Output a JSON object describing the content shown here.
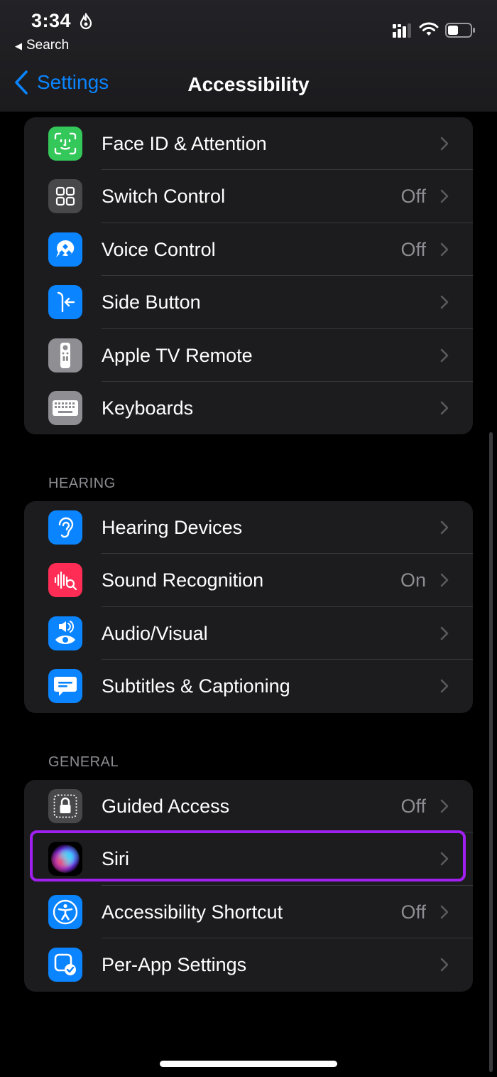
{
  "status_bar": {
    "time": "3:34",
    "back_app": "Search",
    "icons": [
      "focus-mode-icon",
      "cellular-signal-icon",
      "wifi-icon",
      "battery-icon"
    ]
  },
  "nav": {
    "back_label": "Settings",
    "title": "Accessibility"
  },
  "groups": {
    "physical": {
      "items": [
        {
          "label": "Face ID & Attention",
          "value": "",
          "icon": "face-id-icon",
          "color": "#34c759"
        },
        {
          "label": "Switch Control",
          "value": "Off",
          "icon": "switch-control-icon",
          "color": "#48484a"
        },
        {
          "label": "Voice Control",
          "value": "Off",
          "icon": "voice-control-icon",
          "color": "#0a84ff"
        },
        {
          "label": "Side Button",
          "value": "",
          "icon": "side-button-icon",
          "color": "#0a84ff"
        },
        {
          "label": "Apple TV Remote",
          "value": "",
          "icon": "apple-tv-remote-icon",
          "color": "#8e8e93"
        },
        {
          "label": "Keyboards",
          "value": "",
          "icon": "keyboard-icon",
          "color": "#8e8e93"
        }
      ]
    },
    "hearing": {
      "header": "HEARING",
      "items": [
        {
          "label": "Hearing Devices",
          "value": "",
          "icon": "ear-icon",
          "color": "#0a84ff"
        },
        {
          "label": "Sound Recognition",
          "value": "On",
          "icon": "sound-recognition-icon",
          "color": "#ff2d55"
        },
        {
          "label": "Audio/Visual",
          "value": "",
          "icon": "audio-visual-icon",
          "color": "#0a84ff"
        },
        {
          "label": "Subtitles & Captioning",
          "value": "",
          "icon": "subtitles-icon",
          "color": "#0a84ff"
        }
      ]
    },
    "general": {
      "header": "GENERAL",
      "items": [
        {
          "label": "Guided Access",
          "value": "Off",
          "icon": "guided-access-lock-icon",
          "color": "#48484a"
        },
        {
          "label": "Siri",
          "value": "",
          "icon": "siri-icon",
          "color": "#000000"
        },
        {
          "label": "Accessibility Shortcut",
          "value": "Off",
          "icon": "accessibility-shortcut-icon",
          "color": "#0a84ff"
        },
        {
          "label": "Per-App Settings",
          "value": "",
          "icon": "per-app-settings-icon",
          "color": "#0a84ff"
        }
      ]
    }
  },
  "colors": {
    "accent": "#0a84ff",
    "highlight": "#a020f0",
    "background": "#000000",
    "cell": "#1c1c1e"
  }
}
